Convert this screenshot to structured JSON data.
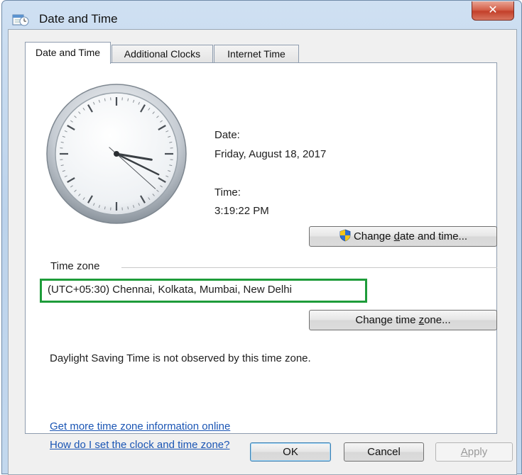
{
  "window": {
    "title": "Date and Time",
    "close_glyph": "✕"
  },
  "tabs": [
    {
      "label": "Date and Time",
      "active": true
    },
    {
      "label": "Additional Clocks",
      "active": false
    },
    {
      "label": "Internet Time",
      "active": false
    }
  ],
  "date": {
    "label": "Date:",
    "value": "Friday, August 18, 2017"
  },
  "time": {
    "label": "Time:",
    "value": "3:19:22 PM"
  },
  "clock": {
    "hours": 3,
    "minutes": 19,
    "seconds": 22
  },
  "buttons": {
    "change_date_time": {
      "pre": "Change ",
      "u": "d",
      "post": "ate and time..."
    },
    "change_time_zone": {
      "pre": "Change time ",
      "u": "z",
      "post": "one..."
    }
  },
  "time_zone": {
    "heading": "Time zone",
    "value": "(UTC+05:30) Chennai, Kolkata, Mumbai, New Delhi",
    "highlight_color": "#1e9c3a"
  },
  "dst_note": "Daylight Saving Time is not observed by this time zone.",
  "links": {
    "more_info": "Get more time zone information online",
    "how_to": "How do I set the clock and time zone?"
  },
  "footer": {
    "ok": "OK",
    "cancel": "Cancel",
    "apply": {
      "u": "A",
      "post": "pply"
    }
  },
  "icons": {
    "title": "calendar-clock-icon",
    "uac": "uac-shield-icon"
  }
}
